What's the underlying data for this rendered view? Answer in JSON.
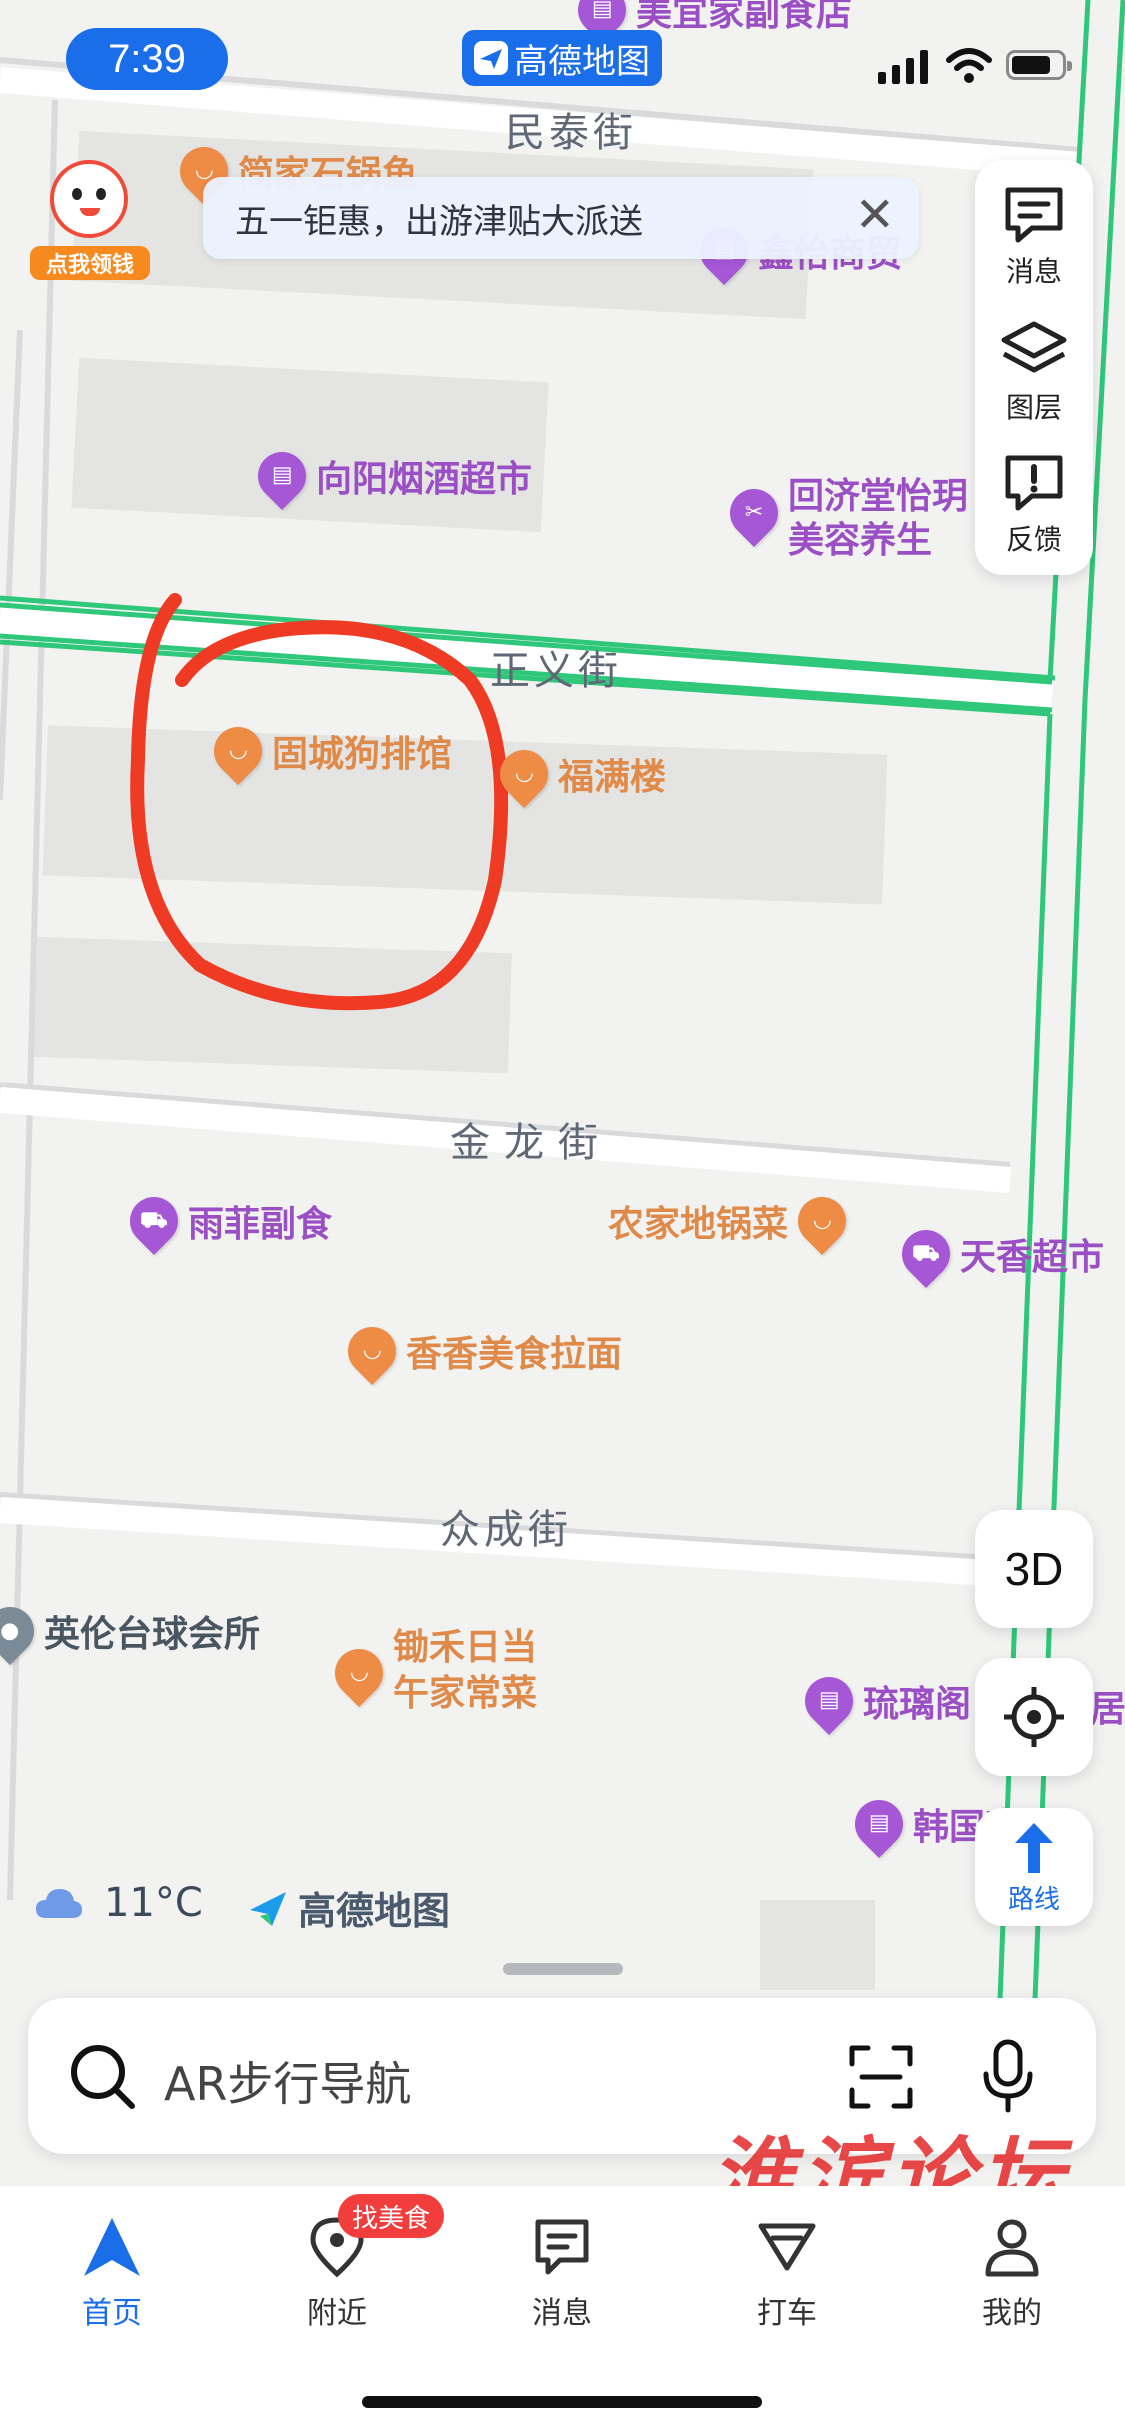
{
  "status_bar": {
    "time": "7:39",
    "app_name": "高德地图"
  },
  "top_cut_poi": {
    "label": "美宜家副食店"
  },
  "banner": {
    "text": "五一钜惠，出游津贴大派送",
    "close_symbol": "✕"
  },
  "promo": {
    "label": "点我领钱"
  },
  "side_panel": {
    "items": [
      {
        "label": "消息",
        "icon": "message-icon"
      },
      {
        "label": "图层",
        "icon": "layers-icon"
      },
      {
        "label": "反馈",
        "icon": "feedback-icon"
      }
    ]
  },
  "map": {
    "streets": [
      "民泰街",
      "正义街",
      "金龙街",
      "众成街"
    ],
    "pois": [
      {
        "label": "简家石锅鱼",
        "kind": "restaurant",
        "color": "orange"
      },
      {
        "label": "鑫怡商贸",
        "kind": "shop",
        "color": "purple"
      },
      {
        "label": "向阳烟酒超市",
        "kind": "shop",
        "color": "purple"
      },
      {
        "label": "回济堂怡玥",
        "label2": "美容养生",
        "kind": "beauty",
        "color": "purple"
      },
      {
        "label": "固城狗排馆",
        "kind": "restaurant",
        "color": "orange"
      },
      {
        "label": "福满楼",
        "kind": "restaurant",
        "color": "orange"
      },
      {
        "label": "雨菲副食",
        "kind": "shop",
        "color": "purple"
      },
      {
        "label": "农家地锅菜",
        "kind": "restaurant",
        "color": "orange"
      },
      {
        "label": "天香超市",
        "kind": "shop",
        "color": "purple"
      },
      {
        "label": "香香美食拉面",
        "kind": "restaurant",
        "color": "orange"
      },
      {
        "label": "英伦台球会所",
        "kind": "place",
        "color": "gray"
      },
      {
        "label": "锄禾日当",
        "label2": "午家常菜",
        "kind": "restaurant",
        "color": "orange"
      },
      {
        "label": "琉璃阁",
        "kind": "shop",
        "color": "purple"
      },
      {
        "label": "韩国宴",
        "kind": "shop",
        "color": "purple"
      },
      {
        "label": "居",
        "kind": "place",
        "color": "purple"
      }
    ]
  },
  "controls": {
    "three_d": "3D",
    "route": "路线"
  },
  "weather": {
    "temp": "11°C"
  },
  "map_logo": {
    "text": "高德地图"
  },
  "search": {
    "placeholder": "AR步行导航"
  },
  "tabs": [
    {
      "label": "首页",
      "active": true
    },
    {
      "label": "附近",
      "badge": "找美食"
    },
    {
      "label": "消息"
    },
    {
      "label": "打车"
    },
    {
      "label": "我的"
    }
  ],
  "watermark": {
    "text": "淮滨论坛"
  },
  "colors": {
    "accent": "#1b6ee9",
    "road_green": "#2fc77a",
    "annotation_red": "#ef3a24"
  }
}
